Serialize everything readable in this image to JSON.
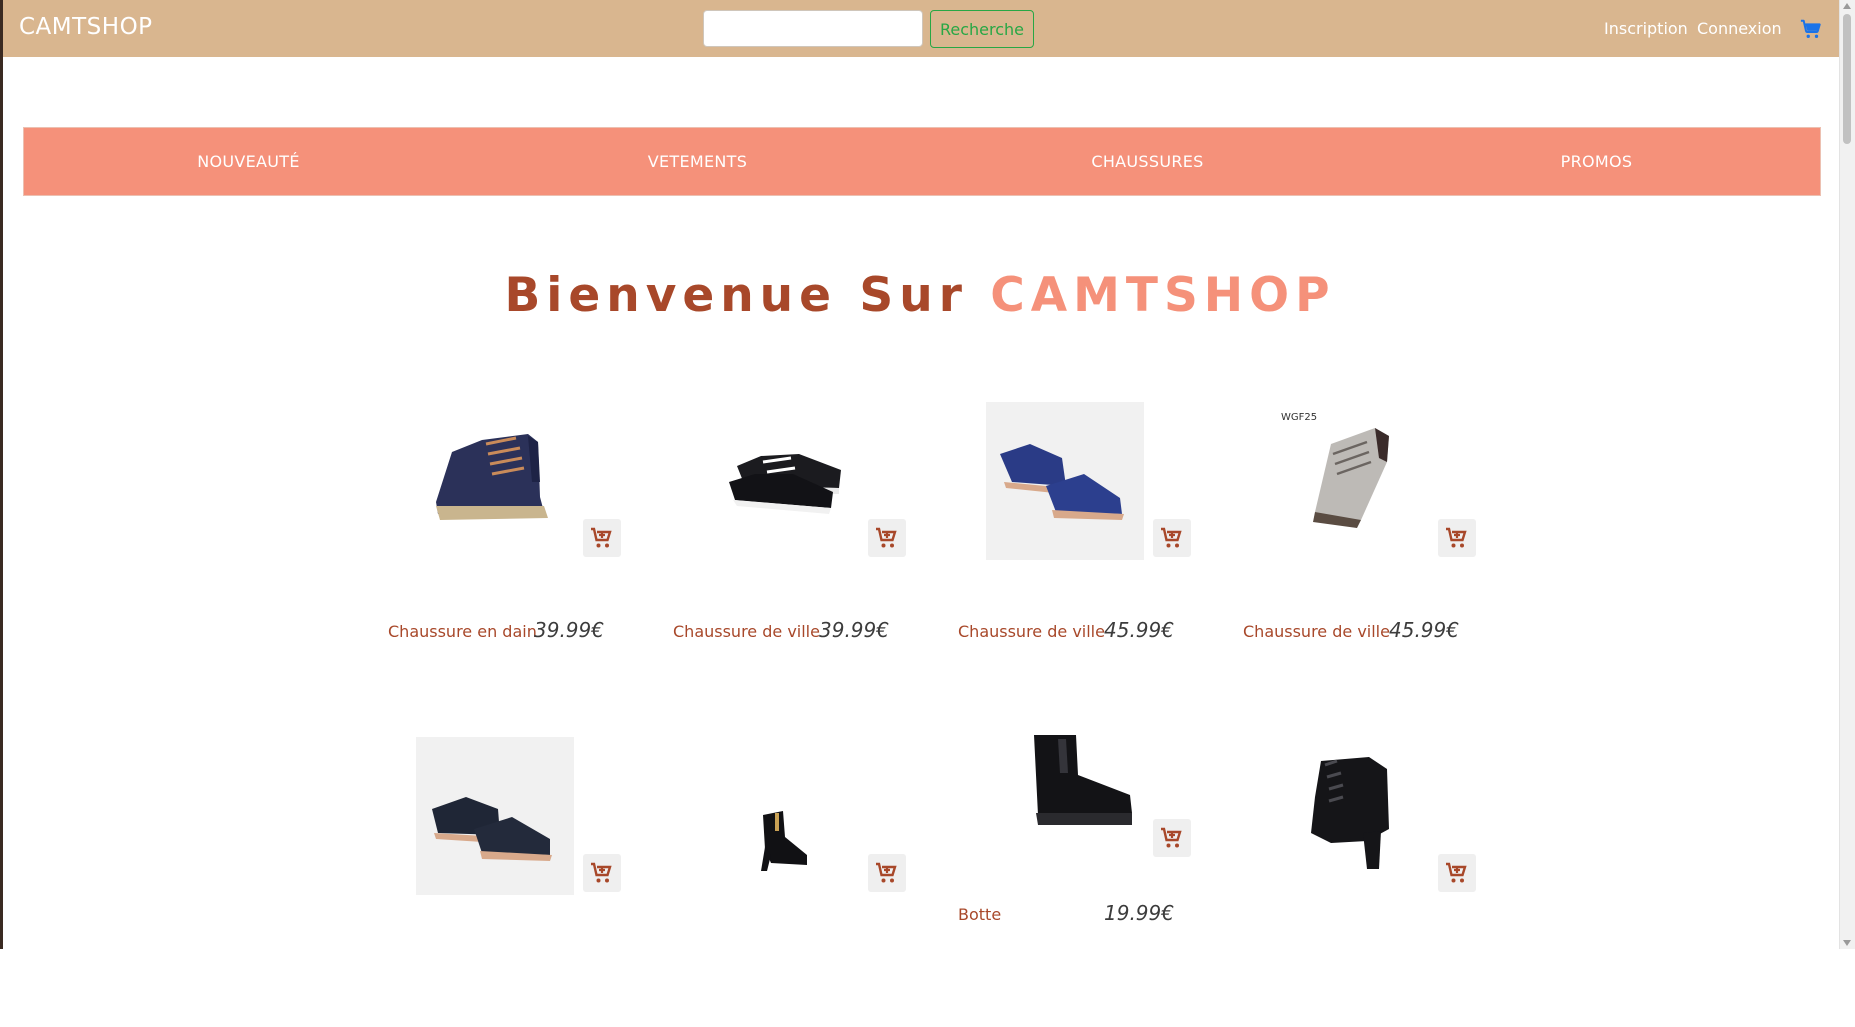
{
  "navbar": {
    "brand": "CAMTSHOP",
    "search_placeholder": "",
    "search_button": "Recherche",
    "signup": "Inscription",
    "login": "Connexion",
    "cart_icon": "cart-icon",
    "background": "#d9b68f"
  },
  "categories": [
    "NOUVEAUTÉ",
    "VETEMENTS",
    "CHAUSSURES",
    "PROMOS"
  ],
  "hero": {
    "prefix": "Bienvenue Sur",
    "brand": "CAMTSHOP"
  },
  "colors": {
    "accent": "#f5917a",
    "brown": "#a8482a",
    "price": "#3c3c3c",
    "success": "#28a745"
  },
  "products": [
    {
      "name": "Chaussure en dain",
      "price": "39.99€",
      "image": "navy suede ankle boot"
    },
    {
      "name": "Chaussure de ville",
      "price": "39.99€",
      "image": "black suede sneaker pair"
    },
    {
      "name": "Chaussure de ville",
      "price": "45.99€",
      "image": "navy leather derby pair"
    },
    {
      "name": "Chaussure de ville",
      "price": "45.99€",
      "image": "grey suede derby",
      "watermark": "WGF25"
    },
    {
      "name": "",
      "price": "",
      "image": "black derby pair"
    },
    {
      "name": "",
      "price": "",
      "image": "black ankle boot"
    },
    {
      "name": "Botte",
      "price": "19.99€",
      "image": "black chelsea boot"
    },
    {
      "name": "",
      "price": "",
      "image": "black lace-up heel bootie"
    }
  ]
}
